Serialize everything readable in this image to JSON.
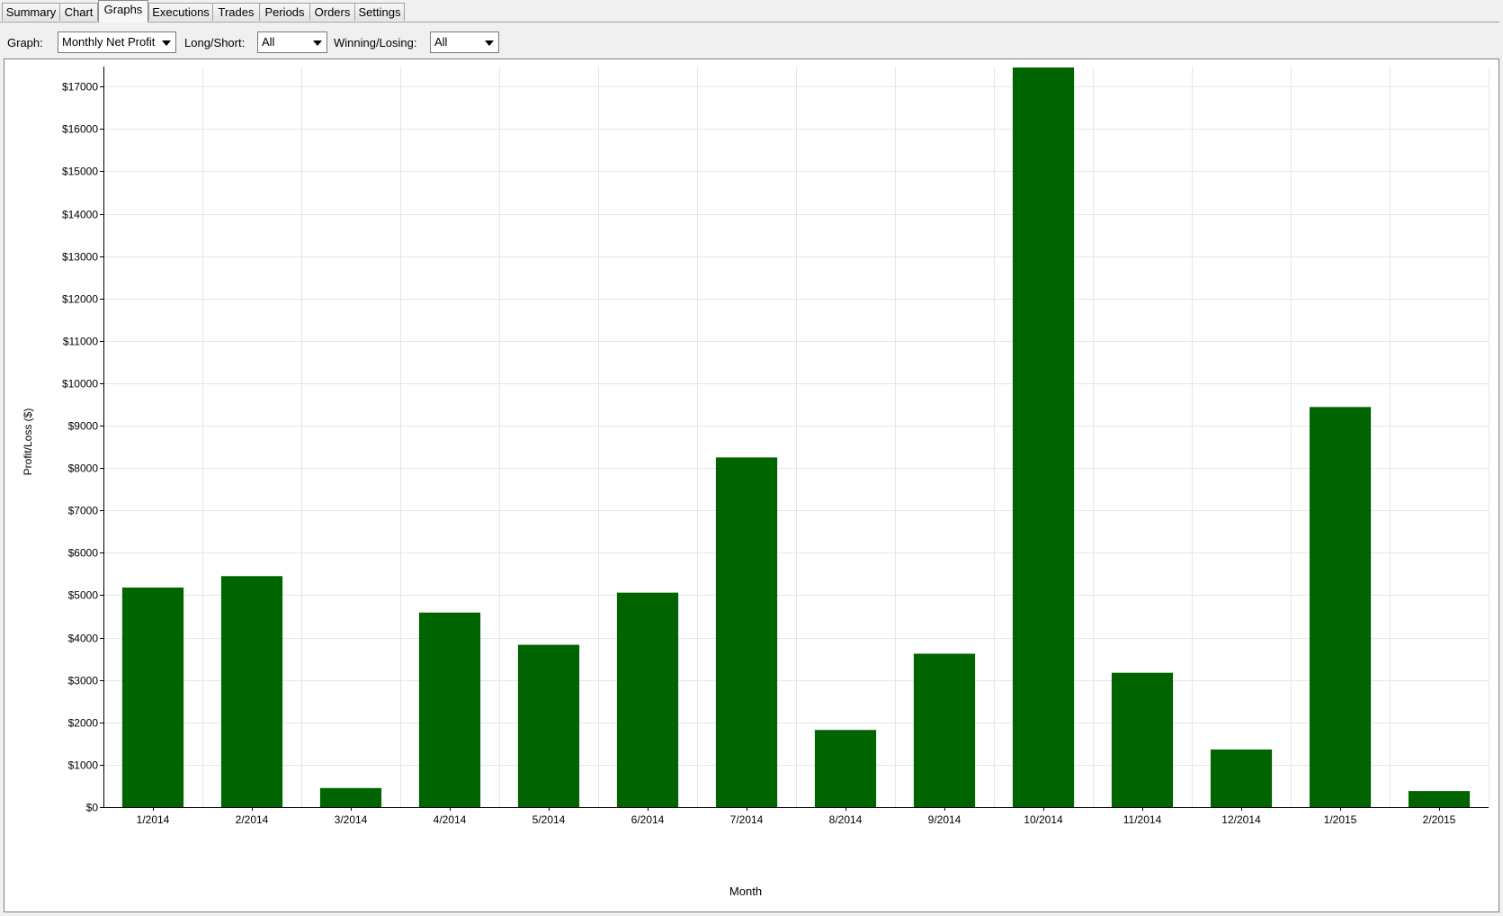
{
  "tabs": [
    {
      "label": "Summary",
      "active": false
    },
    {
      "label": "Chart",
      "active": false
    },
    {
      "label": "Graphs",
      "active": true
    },
    {
      "label": "Executions",
      "active": false
    },
    {
      "label": "Trades",
      "active": false
    },
    {
      "label": "Periods",
      "active": false
    },
    {
      "label": "Orders",
      "active": false
    },
    {
      "label": "Settings",
      "active": false
    }
  ],
  "toolbar": {
    "graph_label": "Graph:",
    "graph_value": "Monthly Net Profit",
    "longshort_label": "Long/Short:",
    "longshort_value": "All",
    "winlose_label": "Winning/Losing:",
    "winlose_value": "All"
  },
  "colors": {
    "bar": "#006400",
    "grid": "#e6e6e6",
    "axis": "#000000"
  },
  "chart_data": {
    "type": "bar",
    "title": "",
    "xlabel": "Month",
    "ylabel": "Profit/Loss ($)",
    "categories": [
      "1/2014",
      "2/2014",
      "3/2014",
      "4/2014",
      "5/2014",
      "6/2014",
      "7/2014",
      "8/2014",
      "9/2014",
      "10/2014",
      "11/2014",
      "12/2014",
      "1/2015",
      "2/2015"
    ],
    "values": [
      5180,
      5450,
      450,
      4590,
      3830,
      5060,
      8250,
      1820,
      3620,
      17450,
      3170,
      1360,
      9440,
      380
    ],
    "ylim": [
      0,
      17450
    ],
    "yticks": [
      0,
      1000,
      2000,
      3000,
      4000,
      5000,
      6000,
      7000,
      8000,
      9000,
      10000,
      11000,
      12000,
      13000,
      14000,
      15000,
      16000,
      17000
    ],
    "ytick_labels": [
      "$0",
      "$1000",
      "$2000",
      "$3000",
      "$4000",
      "$5000",
      "$6000",
      "$7000",
      "$8000",
      "$9000",
      "$10000",
      "$11000",
      "$12000",
      "$13000",
      "$14000",
      "$15000",
      "$16000",
      "$17000"
    ],
    "grid": true,
    "legend": "none"
  }
}
